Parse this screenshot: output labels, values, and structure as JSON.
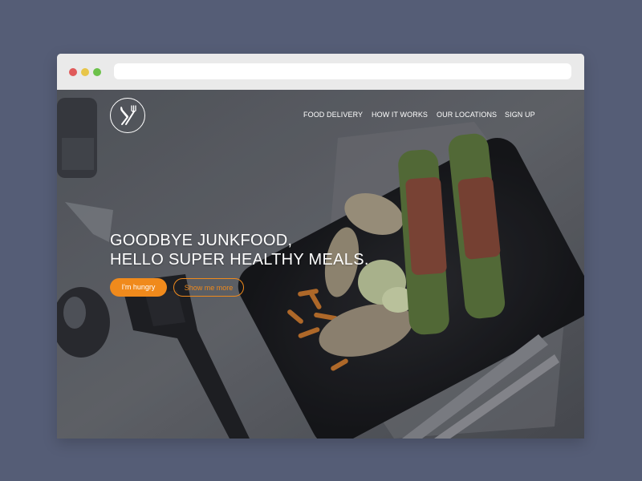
{
  "browser": {
    "controls": [
      "close",
      "minimize",
      "maximize"
    ]
  },
  "site": {
    "logo_icon": "fork-spoon-icon",
    "nav": [
      {
        "label": "FOOD DELIVERY"
      },
      {
        "label": "HOW IT WORKS"
      },
      {
        "label": "OUR LOCATIONS"
      },
      {
        "label": "SIGN UP"
      }
    ],
    "hero": {
      "headline_line1": "GOODBYE JUNKFOOD,",
      "headline_line2": "HELLO SUPER HEALTHY MEALS.",
      "primary_button": "I'm hungry",
      "secondary_button": "Show me more"
    }
  },
  "colors": {
    "accent": "#f08a1c",
    "background": "#555d76",
    "nav_text": "#ffffff"
  }
}
